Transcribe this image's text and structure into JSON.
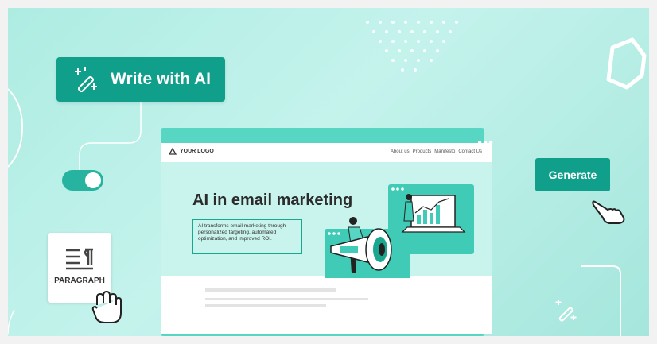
{
  "write_ai": {
    "label": "Write with AI"
  },
  "paragraph": {
    "label": "PARAGRAPH"
  },
  "generate": {
    "label": "Generate"
  },
  "mockup": {
    "logo": "YOUR LOGO",
    "nav": [
      "About us",
      "Products",
      "Manifesto",
      "Contact Us"
    ],
    "headline": "AI in email marketing",
    "blurb": "AI transforms email marketing through personalized targeting, automated optimization, and improved ROI."
  },
  "colors": {
    "accent": "#0f9f8a",
    "bg": "#b6eee5",
    "panel": "#58d6c4"
  }
}
